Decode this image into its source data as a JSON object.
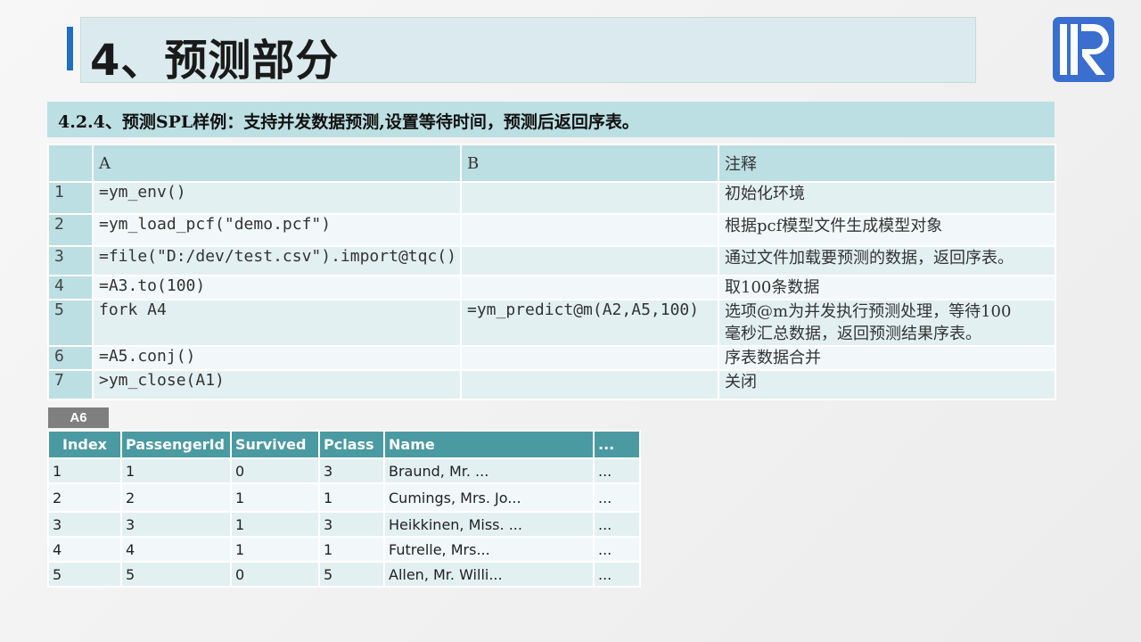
{
  "title": "4、预测部分",
  "subtitle": "4.2.4、预测SPL样例：支持并发数据预测,设置等待时间，预测后返回序表。",
  "spl_table": {
    "headers": [
      "",
      "A",
      "B",
      "注释"
    ],
    "rows": [
      {
        "num": "1",
        "a": "=ym_env()",
        "b": "",
        "note": "初始化环境"
      },
      {
        "num": "2",
        "a": "=ym_load_pcf(\"demo.pcf\")",
        "b": "",
        "note": "根据pcf模型文件生成模型对象"
      },
      {
        "num": "3",
        "a": "=file(\"D:/dev/test.csv\").import@tqc()",
        "b": "",
        "note": "通过文件加载要预测的数据，返回序表。"
      },
      {
        "num": "4",
        "a": "=A3.to(100)",
        "b": "",
        "note": "取100条数据"
      },
      {
        "num": "5",
        "a": "fork A4",
        "b": "=ym_predict@m(A2,A5,100)",
        "note": "选项@m为并发执行预测处理，等待100",
        "note2": "毫秒汇总数据，返回预测结果序表。"
      },
      {
        "num": "6",
        "a": "=A5.conj()",
        "b": "",
        "note": "序表数据合并"
      },
      {
        "num": "7",
        "a": ">ym_close(A1)",
        "b": "",
        "note": "关闭"
      }
    ]
  },
  "result_label": "A6",
  "result_table": {
    "headers": [
      "Index",
      "PassengerId",
      "Survived",
      "Pclass",
      "Name",
      "..."
    ],
    "rows": [
      [
        "1",
        "1",
        "0",
        "3",
        "Braund, Mr. ...",
        "..."
      ],
      [
        "2",
        "2",
        "1",
        "1",
        "Cumings, Mrs. Jo...",
        "..."
      ],
      [
        "3",
        "3",
        "1",
        "3",
        "Heikkinen, Miss. ...",
        "..."
      ],
      [
        "4",
        "4",
        "1",
        "1",
        "Futrelle, Mrs...",
        "..."
      ],
      [
        "5",
        "5",
        "0",
        "5",
        "Allen, Mr. Willi...",
        "..."
      ]
    ]
  },
  "colors": {
    "accent": "#1f6fc2",
    "header": "#bcdfe3",
    "result_header": "#4a9aa2",
    "logo": "#3a6fd0"
  },
  "logo_icon": "raqsoft-r-logo"
}
